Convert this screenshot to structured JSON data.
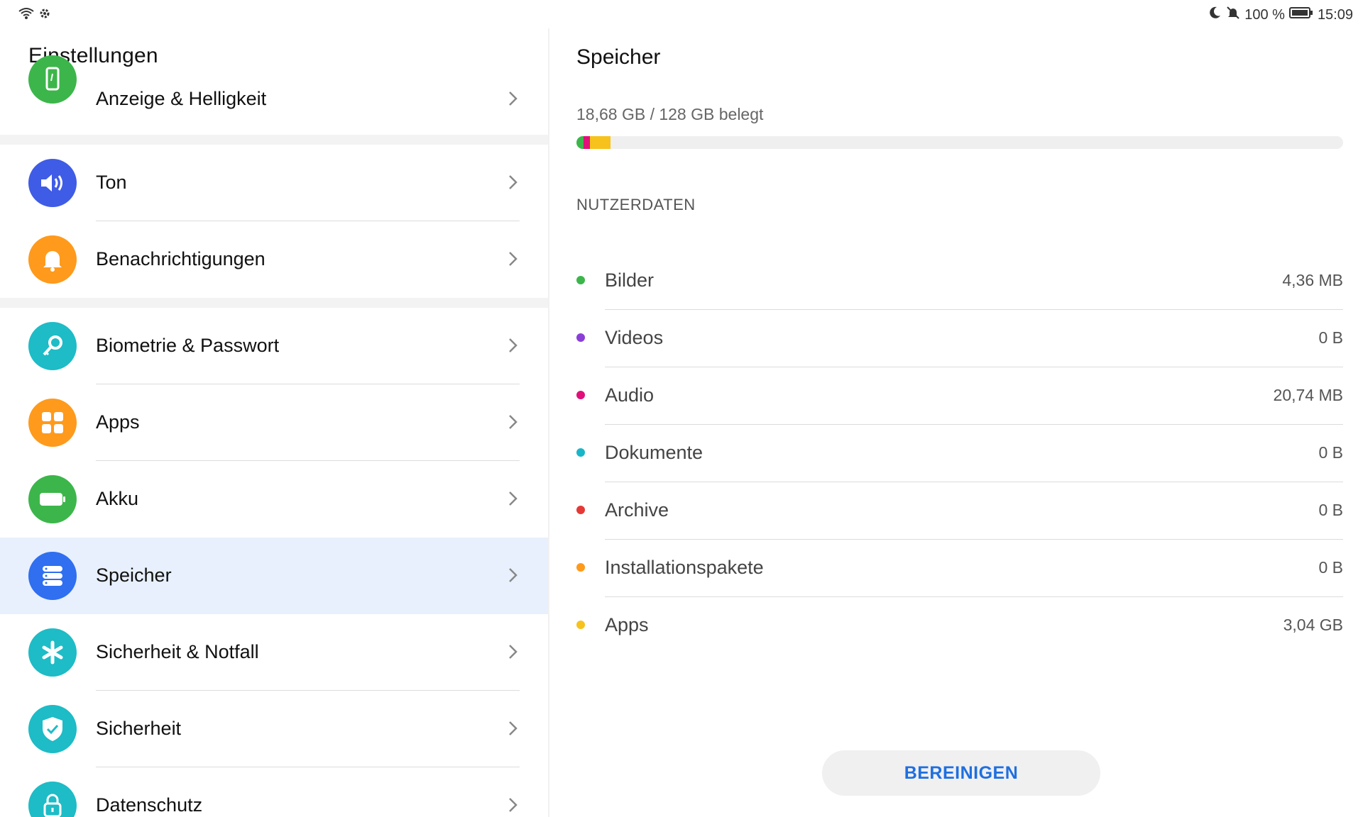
{
  "status_bar": {
    "battery_percent": "100 %",
    "time": "15:09",
    "left_icons": [
      "wifi-icon",
      "gear-icon"
    ],
    "right_icons": [
      "moon-icon",
      "bell-off-icon",
      "battery-icon"
    ]
  },
  "left": {
    "title": "Einstellungen",
    "items": [
      {
        "label": "Anzeige & Helligkeit",
        "icon": "display-icon",
        "color": "#3cb64a"
      },
      {
        "label": "Ton",
        "icon": "speaker-icon",
        "color": "#3f5ce6"
      },
      {
        "label": "Benachrichtigungen",
        "icon": "bell-icon",
        "color": "#ff9a1c"
      },
      {
        "label": "Biometrie & Passwort",
        "icon": "key-icon",
        "color": "#1dbcc6"
      },
      {
        "label": "Apps",
        "icon": "apps-grid-icon",
        "color": "#ff9a1c"
      },
      {
        "label": "Akku",
        "icon": "battery-icon",
        "color": "#3cb64a"
      },
      {
        "label": "Speicher",
        "icon": "storage-icon",
        "color": "#2f6ff0",
        "selected": true
      },
      {
        "label": "Sicherheit & Notfall",
        "icon": "asterisk-icon",
        "color": "#1dbcc6"
      },
      {
        "label": "Sicherheit",
        "icon": "shield-icon",
        "color": "#1dbcc6"
      },
      {
        "label": "Datenschutz",
        "icon": "lock-icon",
        "color": "#1dbcc6"
      }
    ]
  },
  "right": {
    "title": "Speicher",
    "usage_text": "18,68 GB / 128 GB belegt",
    "usage_segments": [
      {
        "name": "green",
        "color": "#3cb64a",
        "fraction": 0.009
      },
      {
        "name": "magenta",
        "color": "#e0107a",
        "fraction": 0.009
      },
      {
        "name": "yellow",
        "color": "#f7c21c",
        "fraction": 0.026
      }
    ],
    "section_title": "NUTZERDATEN",
    "rows": [
      {
        "label": "Bilder",
        "value": "4,36 MB",
        "color": "#3cb64a"
      },
      {
        "label": "Videos",
        "value": "0 B",
        "color": "#8a3fd6"
      },
      {
        "label": "Audio",
        "value": "20,74 MB",
        "color": "#e0107a"
      },
      {
        "label": "Dokumente",
        "value": "0 B",
        "color": "#18b6c8"
      },
      {
        "label": "Archive",
        "value": "0 B",
        "color": "#e53935"
      },
      {
        "label": "Installationspakete",
        "value": "0 B",
        "color": "#ff9a1c"
      },
      {
        "label": "Apps",
        "value": "3,04 GB",
        "color": "#f7c21c"
      }
    ],
    "clean_button": "BEREINIGEN"
  }
}
